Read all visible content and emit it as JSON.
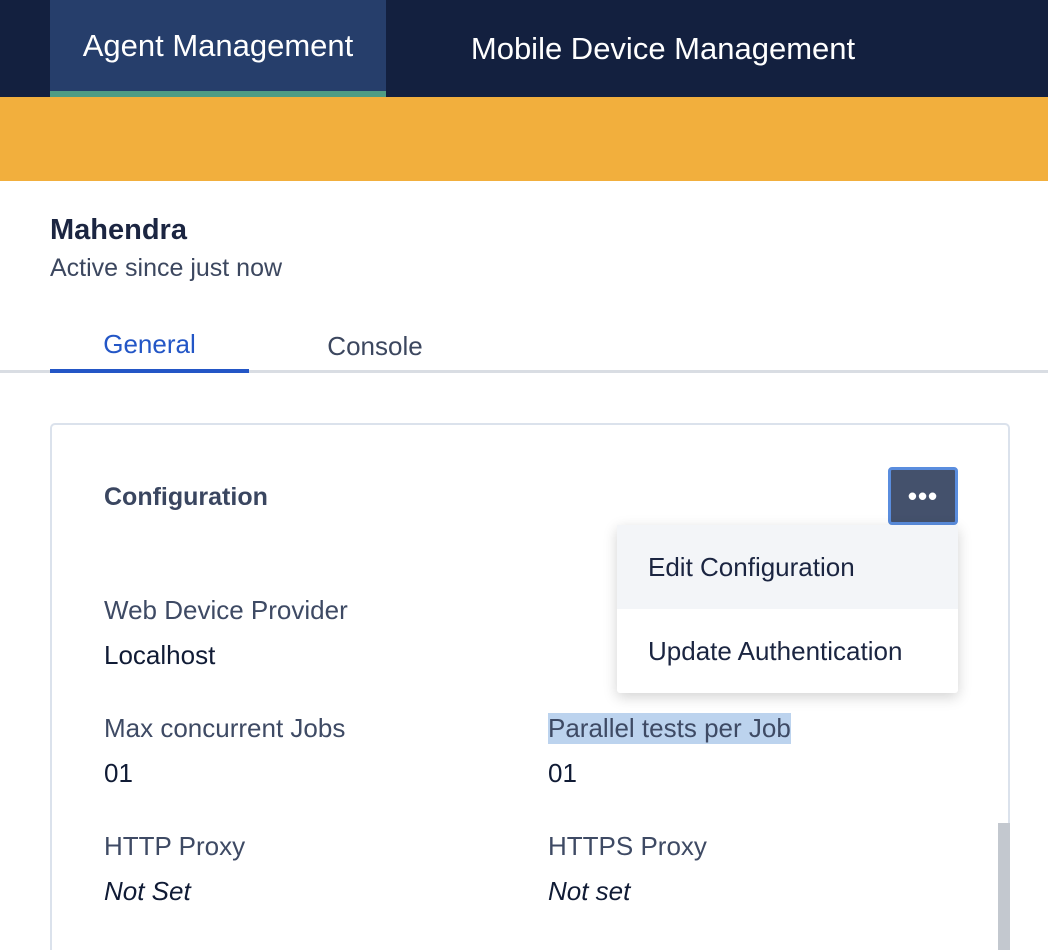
{
  "top_nav": {
    "tabs": [
      {
        "label": "Agent Management",
        "active": true
      },
      {
        "label": "Mobile Device Management",
        "active": false
      }
    ]
  },
  "banner": {
    "color": "#f2af3d"
  },
  "agent": {
    "name": "Mahendra",
    "status": "Active since just now"
  },
  "tabs": [
    {
      "label": "General",
      "active": true
    },
    {
      "label": "Console",
      "active": false
    }
  ],
  "configuration": {
    "title": "Configuration",
    "menu_button_label": "•••",
    "fields": {
      "web_device_provider": {
        "label": "Web Device Provider",
        "value": "Localhost"
      },
      "max_concurrent_jobs": {
        "label": "Max concurrent Jobs",
        "value": "01"
      },
      "parallel_tests_per_job": {
        "label": "Parallel tests per Job",
        "value": "01"
      },
      "http_proxy": {
        "label": "HTTP Proxy",
        "value": "Not Set"
      },
      "https_proxy": {
        "label": "HTTPS Proxy",
        "value": "Not set"
      }
    }
  },
  "dropdown_menu": {
    "items": [
      {
        "label": "Edit Configuration"
      },
      {
        "label": "Update Authentication"
      }
    ]
  },
  "colors": {
    "nav_background": "#13203f",
    "nav_active": "#263e6b",
    "nav_active_underline": "#4f9c84",
    "tab_active": "#2356c6",
    "menu_button": "#44516c"
  }
}
